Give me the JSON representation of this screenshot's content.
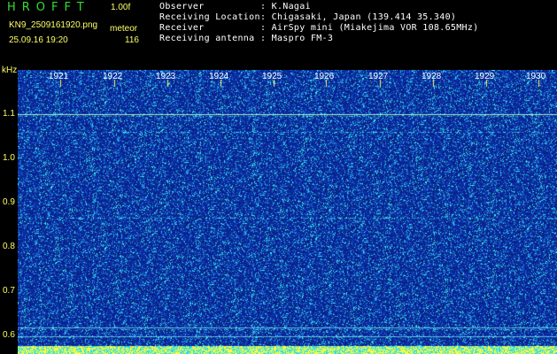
{
  "header": {
    "app_name": "HROFFT",
    "version": "1.00f",
    "filename": "KN9_2509161920.png",
    "mode": "meteor",
    "datetime": "25.09.16 19:20",
    "count": "116"
  },
  "info": [
    {
      "label": "Observer",
      "value": ": K.Nagai"
    },
    {
      "label": "Receiving Location",
      "value": ": Chigasaki, Japan (139.414 35.340)"
    },
    {
      "label": "Receiver",
      "value": ": AirSpy mini (Miakejima VOR 108.65MHz)"
    },
    {
      "label": "Receiving antenna",
      "value": ": Maspro FM-3"
    }
  ],
  "axis": {
    "y_unit": "kHz",
    "y_labels": [
      "1.1",
      "1.0",
      "0.9",
      "0.8",
      "0.7",
      "0.6"
    ],
    "x_labels": [
      "1921",
      "1922",
      "1923",
      "1924",
      "1925",
      "1926",
      "1927",
      "1928",
      "1929",
      "1930"
    ]
  },
  "colors": {
    "background": "#000000",
    "spectrogram_base": "#0a1e8c",
    "axis_text": "#ffff66",
    "info_text": "#ffffff",
    "brand": "#33dd33",
    "bottom_strip": "#ffff33"
  }
}
